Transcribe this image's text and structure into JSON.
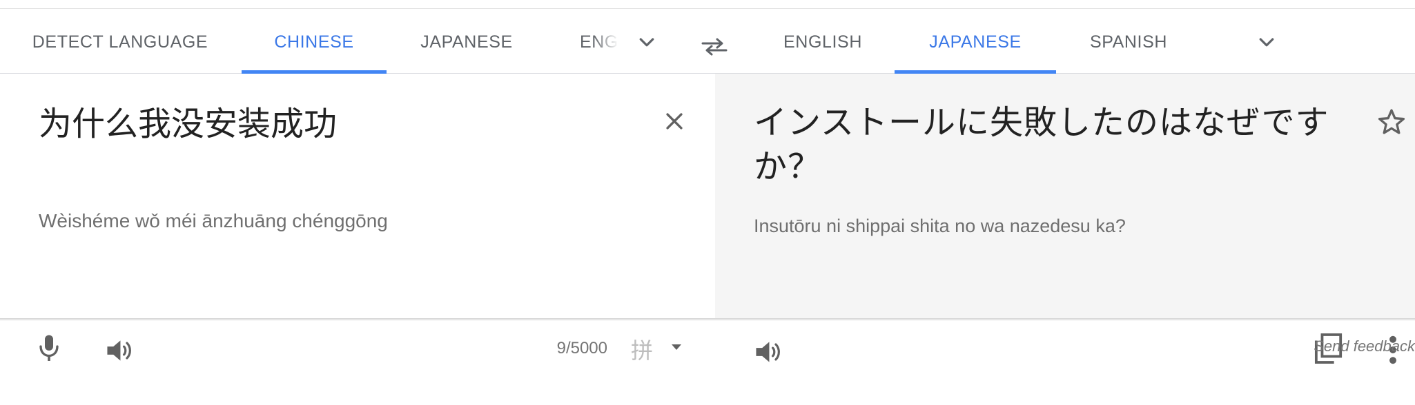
{
  "source_languages": {
    "tabs": [
      {
        "label": "DETECT LANGUAGE"
      },
      {
        "label": "CHINESE"
      },
      {
        "label": "JAPANESE"
      },
      {
        "label": "ENG"
      }
    ],
    "selected": "CHINESE",
    "more_icon": "chevron-down-icon"
  },
  "swap_icon": "swap-languages-icon",
  "target_languages": {
    "tabs": [
      {
        "label": "ENGLISH"
      },
      {
        "label": "JAPANESE"
      },
      {
        "label": "SPANISH"
      }
    ],
    "selected": "JAPANESE",
    "more_icon": "chevron-down-icon"
  },
  "source": {
    "text": "为什么我没安装成功",
    "romanization": "Wèishéme wǒ méi ānzhuāng chénggōng",
    "char_count": "9/5000",
    "ime_glyph": "拼",
    "icons": [
      "close-icon",
      "microphone-icon",
      "speaker-icon",
      "caret-down-icon"
    ]
  },
  "target": {
    "text": "インストールに失敗したのはなぜですか？",
    "romanization": "Insutōru ni shippai shita no wa nazedesu ka?",
    "icons": [
      "star-icon",
      "speaker-icon",
      "copy-icon",
      "more-vert-icon"
    ]
  },
  "footer": {
    "feedback_label": "Send feedback"
  },
  "colors": {
    "accent": "#4285f4",
    "active_tab_text": "#3b78e7",
    "tab_text": "#5f6368",
    "target_panel_bg": "#f5f5f5",
    "icon": "#757575"
  }
}
